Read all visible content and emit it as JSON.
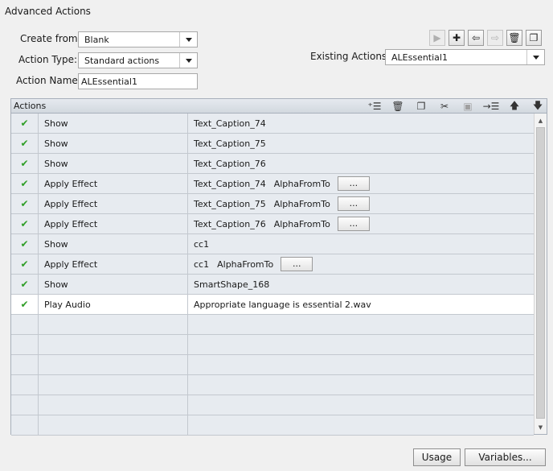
{
  "window": {
    "title": "Advanced Actions"
  },
  "form": {
    "create_from_label": "Create from:",
    "create_from_value": "Blank",
    "action_type_label": "Action Type:",
    "action_type_value": "Standard actions",
    "action_name_label": "Action Name:",
    "action_name_value": "ALEssential1",
    "existing_actions_label": "Existing Actions:",
    "existing_actions_value": "ALEssential1"
  },
  "toolbar": {
    "icons": [
      "preview-icon",
      "add-icon",
      "import-icon",
      "export-icon",
      "delete-icon",
      "duplicate-icon"
    ]
  },
  "actions_panel": {
    "header_label": "Actions",
    "header_icons": [
      "insert-row-icon",
      "delete-row-icon",
      "copy-row-icon",
      "cut-icon",
      "paste-icon",
      "insert-below-icon",
      "move-up-icon",
      "move-down-icon"
    ],
    "rows": [
      {
        "action": "Show",
        "target": "Text_Caption_74",
        "effect": "",
        "has_button": false
      },
      {
        "action": "Show",
        "target": "Text_Caption_75",
        "effect": "",
        "has_button": false
      },
      {
        "action": "Show",
        "target": "Text_Caption_76",
        "effect": "",
        "has_button": false
      },
      {
        "action": "Apply Effect",
        "target": "Text_Caption_74",
        "effect": "AlphaFromTo",
        "has_button": true
      },
      {
        "action": "Apply Effect",
        "target": "Text_Caption_75",
        "effect": "AlphaFromTo",
        "has_button": true
      },
      {
        "action": "Apply Effect",
        "target": "Text_Caption_76",
        "effect": "AlphaFromTo",
        "has_button": true
      },
      {
        "action": "Show",
        "target": "cc1",
        "effect": "",
        "has_button": false
      },
      {
        "action": "Apply Effect",
        "target": "cc1",
        "effect": "AlphaFromTo",
        "has_button": true
      },
      {
        "action": "Show",
        "target": "SmartShape_168",
        "effect": "",
        "has_button": false
      },
      {
        "action": "Play Audio",
        "target": "Appropriate language is essential 2.wav",
        "effect": "",
        "has_button": false,
        "selected": true
      }
    ],
    "empty_rows": 6,
    "ellipsis_label": "..."
  },
  "buttons": {
    "usage": "Usage",
    "variables": "Variables..."
  },
  "colors": {
    "check": "#2f9e27",
    "row_bg": "#e7ebf0",
    "selected_row_bg": "#ffffff"
  }
}
